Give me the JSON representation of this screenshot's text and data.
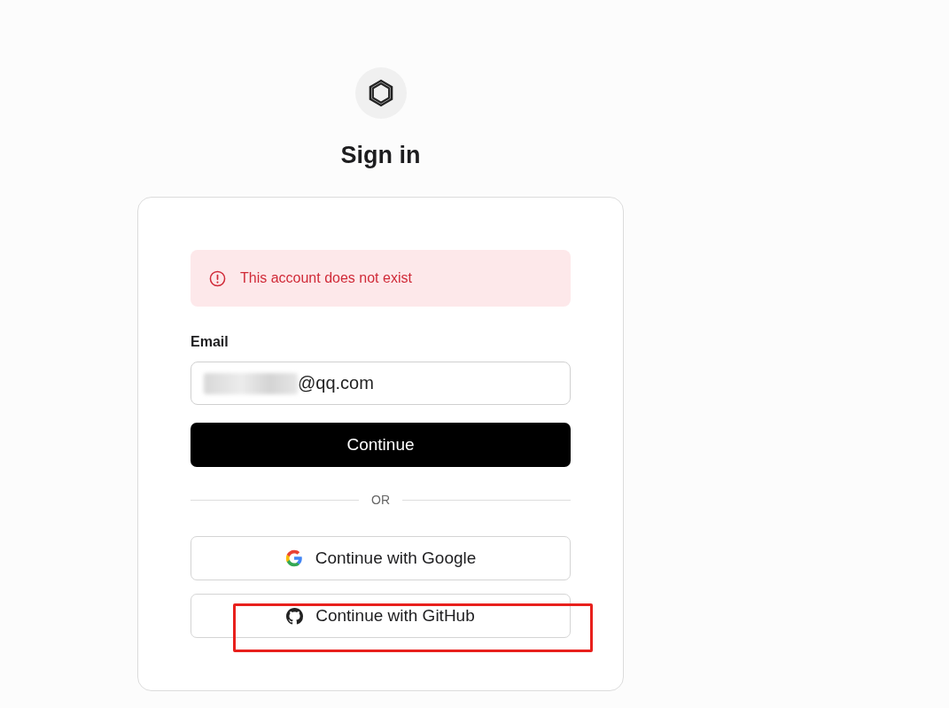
{
  "title": "Sign in",
  "alert": {
    "kind": "error",
    "message": "This account does not exist"
  },
  "email": {
    "label": "Email",
    "value": "@qq.com",
    "redacted": true
  },
  "continue_button": "Continue",
  "divider": "OR",
  "providers": [
    {
      "kind": "google",
      "label": "Continue with Google"
    },
    {
      "kind": "github",
      "label": "Continue with GitHub"
    }
  ],
  "annotations": [
    {
      "kind": "rectangle"
    }
  ]
}
